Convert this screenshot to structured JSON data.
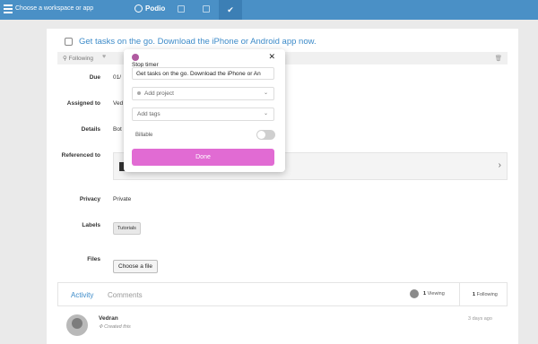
{
  "topbar": {
    "workspace_label": "Choose a workspace or app",
    "logo_text": "Podio",
    "bg_color": "#4a90c6"
  },
  "task": {
    "title": "Get tasks on the go. Download the iPhone or Android app now.",
    "action_follow": "Following",
    "due_label": "Due",
    "due_value": "01/",
    "assigned_label": "Assigned to",
    "assigned_value": "Ved",
    "details_label": "Details",
    "details_value": "Bot",
    "referenced_label": "Referenced to",
    "privacy_label": "Privacy",
    "privacy_value": "Private",
    "labels_label": "Labels",
    "label_tag": "Tutorials",
    "files_label": "Files",
    "file_button": "Choose a file"
  },
  "activity": {
    "tab_activity": "Activity",
    "tab_comments": "Comments",
    "viewing_count": "1",
    "viewing_label": "Viewing",
    "following_count": "1",
    "following_label": "Following",
    "author": "Vedran",
    "created": "Created this",
    "time_ago": "3 days ago"
  },
  "timer_popup": {
    "title": "Stop timer",
    "description": "Get tasks on the go. Download the iPhone or An",
    "project_placeholder": "Add project",
    "tags_placeholder": "Add tags",
    "billable_label": "Billable",
    "billable_on": false,
    "done_label": "Done",
    "accent_color": "#e16bd3"
  }
}
